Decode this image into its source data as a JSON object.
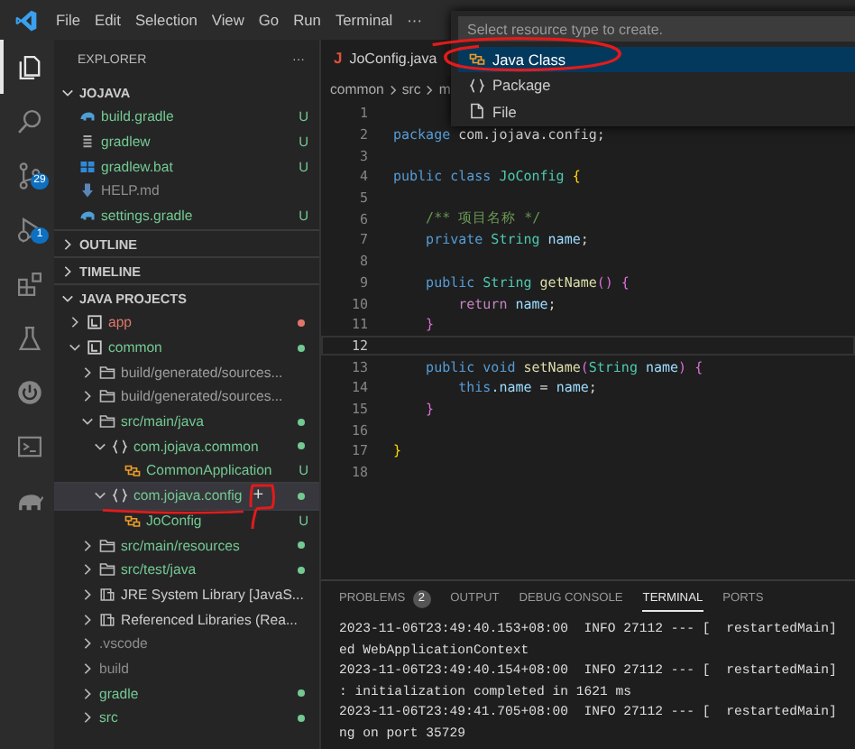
{
  "menu": [
    "File",
    "Edit",
    "Selection",
    "View",
    "Go",
    "Run",
    "Terminal",
    "···"
  ],
  "activity_bar": [
    {
      "kind": "files",
      "selected": true
    },
    {
      "kind": "search",
      "selected": false
    },
    {
      "kind": "source-control",
      "selected": false,
      "badge": "29"
    },
    {
      "kind": "debug",
      "selected": false,
      "badge": "1"
    },
    {
      "kind": "extensions",
      "selected": false
    },
    {
      "kind": "testing",
      "selected": false
    },
    {
      "kind": "power",
      "selected": false
    },
    {
      "kind": "terminal",
      "selected": false
    },
    {
      "kind": "elephant",
      "selected": false
    }
  ],
  "sidebar": {
    "title": "EXPLORER",
    "more": "···",
    "explorer": {
      "title": "JOJAVA",
      "expanded": true,
      "items": [
        {
          "label": "build.gradle",
          "kind": "gradle",
          "color": "#73c991",
          "badge": "U",
          "selected": false
        },
        {
          "label": "gradlew",
          "kind": "script",
          "color": "#73c991",
          "badge": "U",
          "selected": false
        },
        {
          "label": "gradlew.bat",
          "kind": "batch",
          "color": "#73c991",
          "badge": "U",
          "selected": false
        },
        {
          "label": "HELP.md",
          "kind": "markdown",
          "color": "#8c8c8c",
          "selected": false
        },
        {
          "label": "settings.gradle",
          "kind": "gradle",
          "color": "#73c991",
          "badge": "U",
          "selected": false
        }
      ]
    },
    "sections": [
      {
        "title": "OUTLINE",
        "expanded": false
      },
      {
        "title": "TIMELINE",
        "expanded": false
      }
    ],
    "projects": {
      "title": "JAVA PROJECTS",
      "expanded": true,
      "items": [
        {
          "label": "app",
          "kind": "project",
          "color": "#e0776a",
          "dot": true,
          "expanded": false,
          "selected": false
        },
        {
          "label": "common",
          "kind": "project",
          "color": "#73c991",
          "dot": true,
          "expanded": true,
          "selected": false,
          "children": [
            {
              "label": "build/generated/sources...",
              "kind": "folder",
              "color": "#9d9d9d",
              "dot": false,
              "expanded": false,
              "selected": false
            },
            {
              "label": "build/generated/sources...",
              "kind": "folder",
              "color": "#9d9d9d",
              "dot": false,
              "expanded": false,
              "selected": false
            },
            {
              "label": "src/main/java",
              "kind": "folder",
              "color": "#73c991",
              "dot": true,
              "expanded": true,
              "selected": false,
              "children": [
                {
                  "label": "com.jojava.common",
                  "kind": "package",
                  "color": "#73c991",
                  "dot": true,
                  "expanded": true,
                  "selected": false,
                  "children": [
                    {
                      "label": "CommonApplication",
                      "kind": "class",
                      "color": "#73c991",
                      "badge": "U",
                      "selected": false
                    }
                  ]
                },
                {
                  "label": "com.jojava.config",
                  "kind": "package",
                  "color": "#73c991",
                  "dot": true,
                  "expanded": true,
                  "selected": true,
                  "action": "+",
                  "children": [
                    {
                      "label": "JoConfig",
                      "kind": "class",
                      "color": "#73c991",
                      "badge": "U",
                      "selected": false
                    }
                  ]
                }
              ]
            },
            {
              "label": "src/main/resources",
              "kind": "folder",
              "color": "#73c991",
              "dot": true,
              "expanded": false,
              "selected": false
            },
            {
              "label": "src/test/java",
              "kind": "folder",
              "color": "#73c991",
              "dot": true,
              "expanded": false,
              "selected": false
            },
            {
              "label": "JRE System Library [JavaS...",
              "kind": "library",
              "color": "#cccccc",
              "dot": false,
              "expanded": false,
              "selected": false
            },
            {
              "label": "Referenced Libraries (Rea...",
              "kind": "library",
              "color": "#cccccc",
              "dot": false,
              "expanded": false,
              "selected": false
            },
            {
              "label": ".vscode",
              "kind": "plain",
              "color": "#8c8c8c",
              "dot": false,
              "expanded": false,
              "selected": false
            },
            {
              "label": "build",
              "kind": "plain",
              "color": "#8c8c8c",
              "dot": false,
              "expanded": false,
              "selected": false
            },
            {
              "label": "gradle",
              "kind": "plain",
              "color": "#73c991",
              "dot": true,
              "expanded": false,
              "selected": false
            },
            {
              "label": "src",
              "kind": "plain",
              "color": "#73c991",
              "dot": true,
              "expanded": false,
              "selected": false
            }
          ]
        }
      ]
    }
  },
  "editor": {
    "tab": {
      "icon": "J",
      "title": "JoConfig.java",
      "selected": true
    },
    "breadcrumb": [
      "common",
      "src",
      "m"
    ],
    "lines": [
      {
        "n": "1",
        "current": false
      },
      {
        "n": "2",
        "current": false,
        "tokens": [
          {
            "t": "package",
            "kind": "kw"
          },
          {
            "t": " com.jojava.config;",
            "kind": "plain"
          }
        ]
      },
      {
        "n": "3",
        "current": false
      },
      {
        "n": "4",
        "current": false,
        "tokens": [
          {
            "t": "public",
            "kind": "kw"
          },
          {
            "t": " class",
            "kind": "kw"
          },
          {
            "t": " JoConfig",
            "kind": "type"
          },
          {
            "t": " {",
            "kind": "brace"
          }
        ]
      },
      {
        "n": "5",
        "current": false
      },
      {
        "n": "6",
        "current": false,
        "tokens": [
          {
            "t": "    /** 项目名称 */",
            "kind": "comment"
          }
        ]
      },
      {
        "n": "7",
        "current": false,
        "tokens": [
          {
            "t": "    private",
            "kind": "kw"
          },
          {
            "t": " String",
            "kind": "type"
          },
          {
            "t": " name",
            "kind": "var"
          },
          {
            "t": ";",
            "kind": "plain"
          }
        ]
      },
      {
        "n": "8",
        "current": false
      },
      {
        "n": "9",
        "current": false,
        "tokens": [
          {
            "t": "    public",
            "kind": "kw"
          },
          {
            "t": " String",
            "kind": "type"
          },
          {
            "t": " getName",
            "kind": "fn"
          },
          {
            "t": "()",
            "kind": "brace2"
          },
          {
            "t": " {",
            "kind": "brace2"
          }
        ]
      },
      {
        "n": "10",
        "current": false,
        "tokens": [
          {
            "t": "        return",
            "kind": "ctrl"
          },
          {
            "t": " name",
            "kind": "var"
          },
          {
            "t": ";",
            "kind": "plain"
          }
        ]
      },
      {
        "n": "11",
        "current": false,
        "tokens": [
          {
            "t": "    }",
            "kind": "brace2"
          }
        ]
      },
      {
        "n": "12",
        "current": true
      },
      {
        "n": "13",
        "current": false,
        "tokens": [
          {
            "t": "    public",
            "kind": "kw"
          },
          {
            "t": " void",
            "kind": "kw"
          },
          {
            "t": " setName",
            "kind": "fn"
          },
          {
            "t": "(",
            "kind": "brace2"
          },
          {
            "t": "String",
            "kind": "type"
          },
          {
            "t": " name",
            "kind": "var"
          },
          {
            "t": ")",
            "kind": "brace2"
          },
          {
            "t": " {",
            "kind": "brace2"
          }
        ]
      },
      {
        "n": "14",
        "current": false,
        "tokens": [
          {
            "t": "        this",
            "kind": "kw"
          },
          {
            "t": ".name",
            "kind": "var"
          },
          {
            "t": " = ",
            "kind": "plain"
          },
          {
            "t": "name",
            "kind": "var"
          },
          {
            "t": ";",
            "kind": "plain"
          }
        ]
      },
      {
        "n": "15",
        "current": false,
        "tokens": [
          {
            "t": "    }",
            "kind": "brace2"
          }
        ]
      },
      {
        "n": "16",
        "current": false
      },
      {
        "n": "17",
        "current": false,
        "tokens": [
          {
            "t": "}",
            "kind": "brace"
          }
        ]
      },
      {
        "n": "18",
        "current": false
      }
    ]
  },
  "panel": {
    "tabs": [
      {
        "label": "PROBLEMS",
        "badge": "2",
        "selected": false
      },
      {
        "label": "OUTPUT",
        "selected": false
      },
      {
        "label": "DEBUG CONSOLE",
        "selected": false
      },
      {
        "label": "TERMINAL",
        "selected": true
      },
      {
        "label": "PORTS",
        "selected": false
      }
    ],
    "terminal": [
      "2023-11-06T23:49:40.153+08:00  INFO 27112 --- [  restartedMain]",
      "ed WebApplicationContext",
      "2023-11-06T23:49:40.154+08:00  INFO 27112 --- [  restartedMain]",
      ": initialization completed in 1621 ms",
      "2023-11-06T23:49:41.705+08:00  INFO 27112 --- [  restartedMain]",
      "ng on port 35729"
    ]
  },
  "quick_pick": {
    "placeholder": "Select resource type to create.",
    "items": [
      {
        "label": "Java Class",
        "kind": "class",
        "selected": true
      },
      {
        "label": "Package",
        "kind": "package",
        "selected": false
      },
      {
        "label": "File",
        "kind": "file",
        "selected": false
      }
    ]
  }
}
